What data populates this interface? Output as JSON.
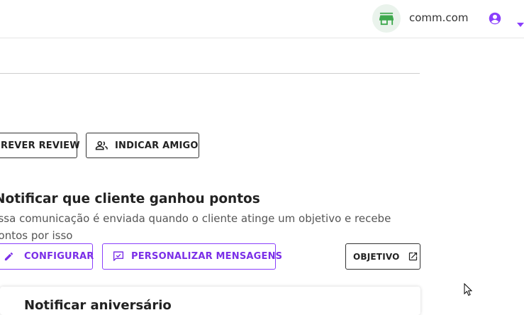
{
  "header": {
    "store_name": "comm.com",
    "store_icon": "storefront-icon",
    "user_icon": "account-circle-icon",
    "menu_icon": "caret-down-icon"
  },
  "actions": {
    "write_review_label": "REVER REVIEW",
    "refer_friend_label": "INDICAR AMIGO"
  },
  "notification": {
    "title": "Notificar que cliente ganhou pontos",
    "description": "Essa comunicação é enviada quando o cliente atinge um objetivo e recebe pontos por isso",
    "configure_label": "CONFIGURAR",
    "customize_label": "PERSONALIZAR MENSAGENS",
    "objective_label": "OBJETIVO"
  },
  "next_card": {
    "title": "Notificar aniversário"
  },
  "colors": {
    "accent": "#8a3ffc",
    "store_green": "#3ea84d",
    "store_bg": "#eaf3ec"
  }
}
